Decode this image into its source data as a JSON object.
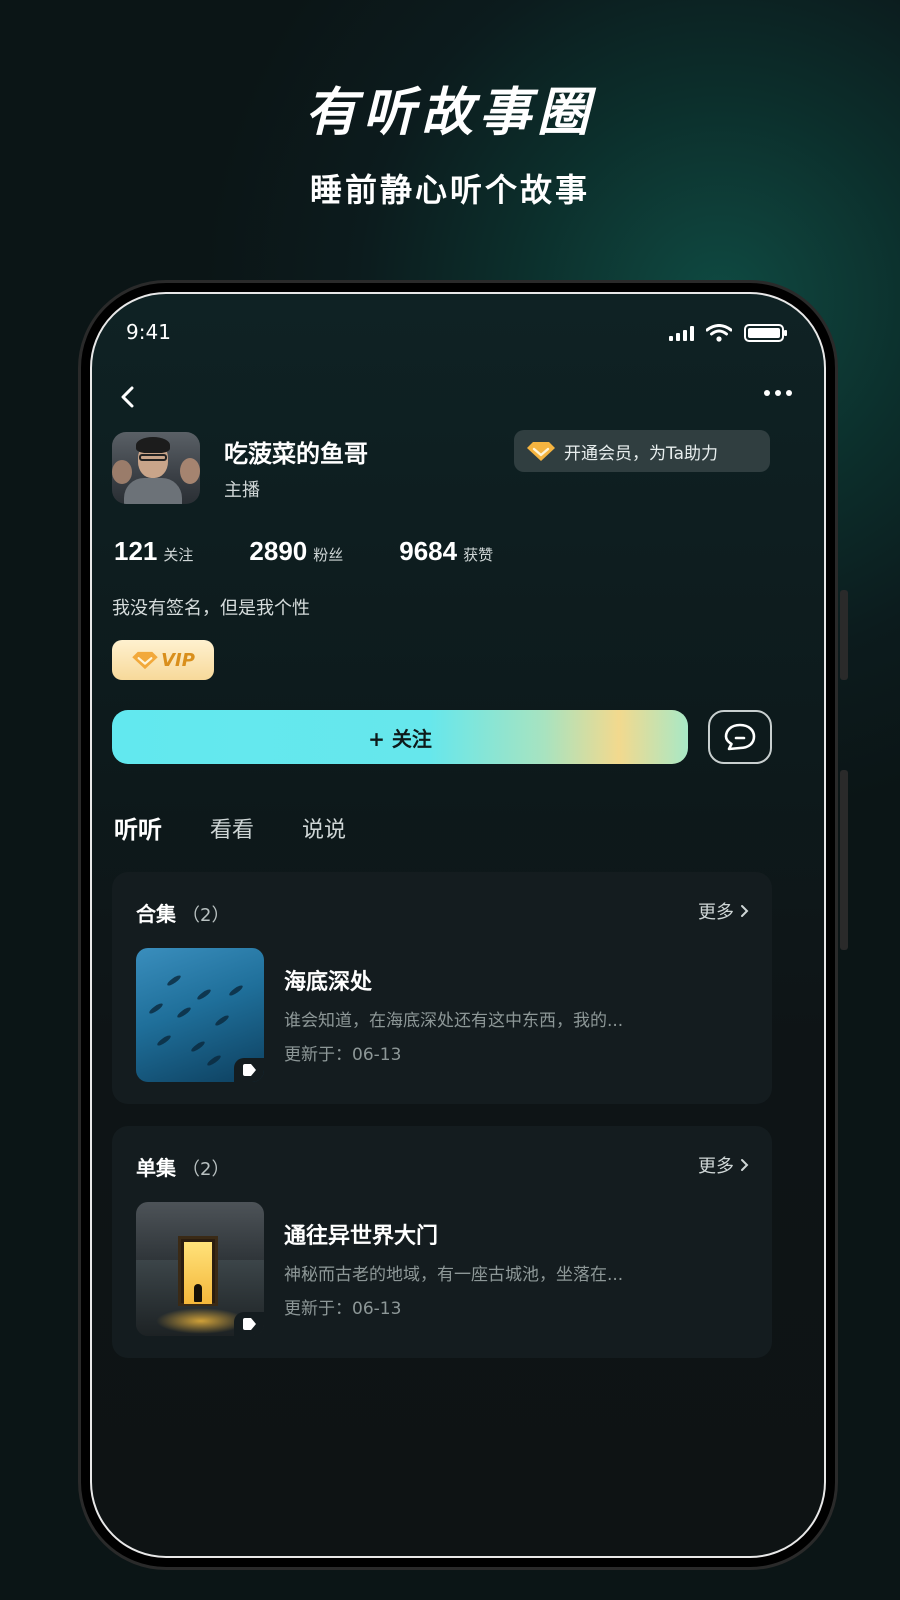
{
  "promo": {
    "title": "有听故事圈",
    "subtitle": "睡前静心听个故事"
  },
  "status_bar": {
    "time": "9:41"
  },
  "profile": {
    "name": "吃菠菜的鱼哥",
    "role": "主播",
    "vip_promo": "开通会员，为Ta助力",
    "signature": "我没有签名，但是我个性",
    "vip_badge": "VIP",
    "stats": [
      {
        "value": "121",
        "label": "关注"
      },
      {
        "value": "2890",
        "label": "粉丝"
      },
      {
        "value": "9684",
        "label": "获赞"
      }
    ]
  },
  "actions": {
    "follow_label": "+ 关注"
  },
  "tabs": [
    "听听",
    "看看",
    "说说"
  ],
  "sections": [
    {
      "title": "合集",
      "count": "（2）",
      "more": "更多",
      "item": {
        "title": "海底深处",
        "desc": "谁会知道，在海底深处还有这中东西，我的...",
        "date": "更新于：06-13"
      }
    },
    {
      "title": "单集",
      "count": "（2）",
      "more": "更多",
      "item": {
        "title": "通往异世界大门",
        "desc": "神秘而古老的地域，有一座古城池，坐落在...",
        "date": "更新于：06-13"
      }
    }
  ],
  "colors": {
    "accent_cyan": "#62e8ef",
    "vip_gold": "#d98f1c",
    "background": "#0c1b1d"
  },
  "icons": [
    "back-icon",
    "more-dots-icon",
    "diamond-icon",
    "chat-bubble-icon",
    "chevron-right-icon",
    "play-icon",
    "signal-icon",
    "wifi-icon",
    "battery-icon"
  ]
}
